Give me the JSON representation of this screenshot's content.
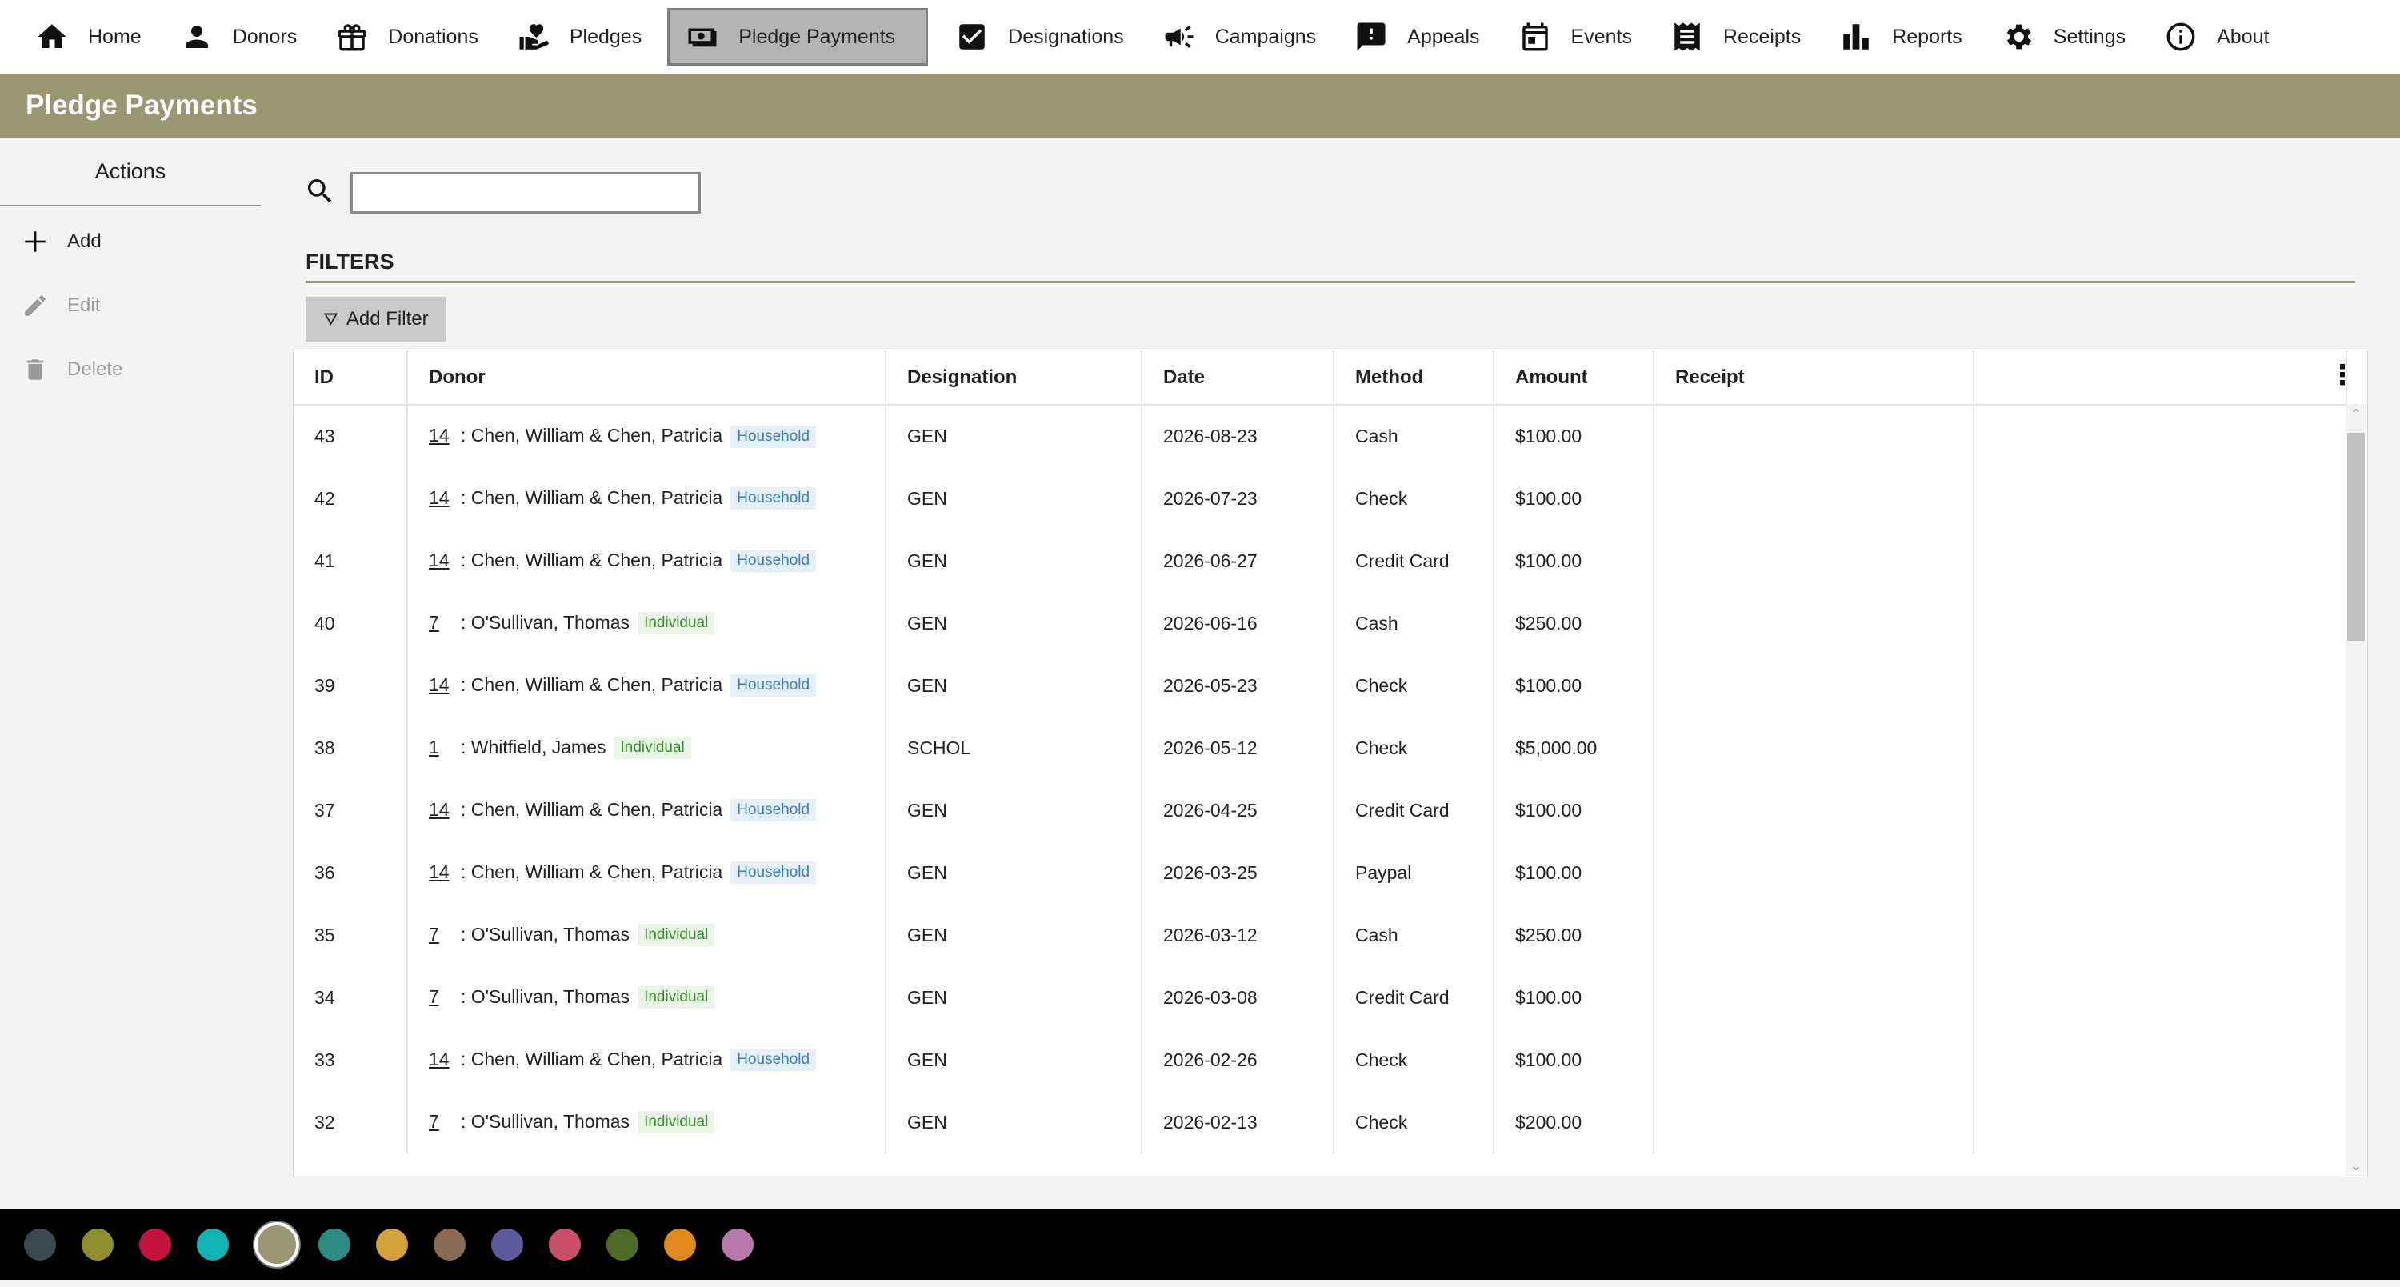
{
  "nav": {
    "items": [
      {
        "label": "Home",
        "icon": "home-icon"
      },
      {
        "label": "Donors",
        "icon": "person-icon"
      },
      {
        "label": "Donations",
        "icon": "gift-icon"
      },
      {
        "label": "Pledges",
        "icon": "hand-heart-icon"
      },
      {
        "label": "Pledge Payments",
        "icon": "cash-icon",
        "active": true
      },
      {
        "label": "Designations",
        "icon": "checkbox-icon"
      },
      {
        "label": "Campaigns",
        "icon": "megaphone-icon"
      },
      {
        "label": "Appeals",
        "icon": "alert-message-icon"
      },
      {
        "label": "Events",
        "icon": "calendar-icon"
      },
      {
        "label": "Receipts",
        "icon": "receipt-icon"
      },
      {
        "label": "Reports",
        "icon": "bar-chart-icon"
      },
      {
        "label": "Settings",
        "icon": "gear-icon"
      },
      {
        "label": "About",
        "icon": "info-icon"
      }
    ]
  },
  "page": {
    "title": "Pledge Payments"
  },
  "sidebar": {
    "header": "Actions",
    "add": "Add",
    "edit": "Edit",
    "delete": "Delete"
  },
  "search": {
    "value": "",
    "placeholder": ""
  },
  "filters": {
    "label": "FILTERS",
    "add_filter": "Add Filter"
  },
  "table": {
    "columns": [
      "ID",
      "Donor",
      "Designation",
      "Date",
      "Method",
      "Amount",
      "Receipt",
      ""
    ],
    "rows": [
      {
        "id": "43",
        "donor_id": "14",
        "donor_name": ": Chen, William & Chen, Patricia",
        "type": "Household",
        "designation": "GEN",
        "date": "2026-08-23",
        "method": "Cash",
        "amount": "$100.00",
        "receipt": ""
      },
      {
        "id": "42",
        "donor_id": "14",
        "donor_name": ": Chen, William & Chen, Patricia",
        "type": "Household",
        "designation": "GEN",
        "date": "2026-07-23",
        "method": "Check",
        "amount": "$100.00",
        "receipt": ""
      },
      {
        "id": "41",
        "donor_id": "14",
        "donor_name": ": Chen, William & Chen, Patricia",
        "type": "Household",
        "designation": "GEN",
        "date": "2026-06-27",
        "method": "Credit Card",
        "amount": "$100.00",
        "receipt": ""
      },
      {
        "id": "40",
        "donor_id": "7",
        "donor_name": ": O'Sullivan, Thomas",
        "type": "Individual",
        "designation": "GEN",
        "date": "2026-06-16",
        "method": "Cash",
        "amount": "$250.00",
        "receipt": ""
      },
      {
        "id": "39",
        "donor_id": "14",
        "donor_name": ": Chen, William & Chen, Patricia",
        "type": "Household",
        "designation": "GEN",
        "date": "2026-05-23",
        "method": "Check",
        "amount": "$100.00",
        "receipt": ""
      },
      {
        "id": "38",
        "donor_id": "1",
        "donor_name": ": Whitfield, James",
        "type": "Individual",
        "designation": "SCHOL",
        "date": "2026-05-12",
        "method": "Check",
        "amount": "$5,000.00",
        "receipt": ""
      },
      {
        "id": "37",
        "donor_id": "14",
        "donor_name": ": Chen, William & Chen, Patricia",
        "type": "Household",
        "designation": "GEN",
        "date": "2026-04-25",
        "method": "Credit Card",
        "amount": "$100.00",
        "receipt": ""
      },
      {
        "id": "36",
        "donor_id": "14",
        "donor_name": ": Chen, William & Chen, Patricia",
        "type": "Household",
        "designation": "GEN",
        "date": "2026-03-25",
        "method": "Paypal",
        "amount": "$100.00",
        "receipt": ""
      },
      {
        "id": "35",
        "donor_id": "7",
        "donor_name": ": O'Sullivan, Thomas",
        "type": "Individual",
        "designation": "GEN",
        "date": "2026-03-12",
        "method": "Cash",
        "amount": "$250.00",
        "receipt": ""
      },
      {
        "id": "34",
        "donor_id": "7",
        "donor_name": ": O'Sullivan, Thomas",
        "type": "Individual",
        "designation": "GEN",
        "date": "2026-03-08",
        "method": "Credit Card",
        "amount": "$100.00",
        "receipt": ""
      },
      {
        "id": "33",
        "donor_id": "14",
        "donor_name": ": Chen, William & Chen, Patricia",
        "type": "Household",
        "designation": "GEN",
        "date": "2026-02-26",
        "method": "Check",
        "amount": "$100.00",
        "receipt": ""
      },
      {
        "id": "32",
        "donor_id": "7",
        "donor_name": ": O'Sullivan, Thomas",
        "type": "Individual",
        "designation": "GEN",
        "date": "2026-02-13",
        "method": "Check",
        "amount": "$200.00",
        "receipt": ""
      }
    ]
  },
  "theme": {
    "accent": "#9a9671",
    "palette": [
      "#3b4a52",
      "#8e8e2c",
      "#c2143c",
      "#14b3b3",
      "#9a9671",
      "#2e8b82",
      "#d4a23a",
      "#8a6a52",
      "#5e5a9e",
      "#c95068",
      "#4e6a28",
      "#e08a1e",
      "#b87aab"
    ],
    "selected_swatch": 4
  }
}
